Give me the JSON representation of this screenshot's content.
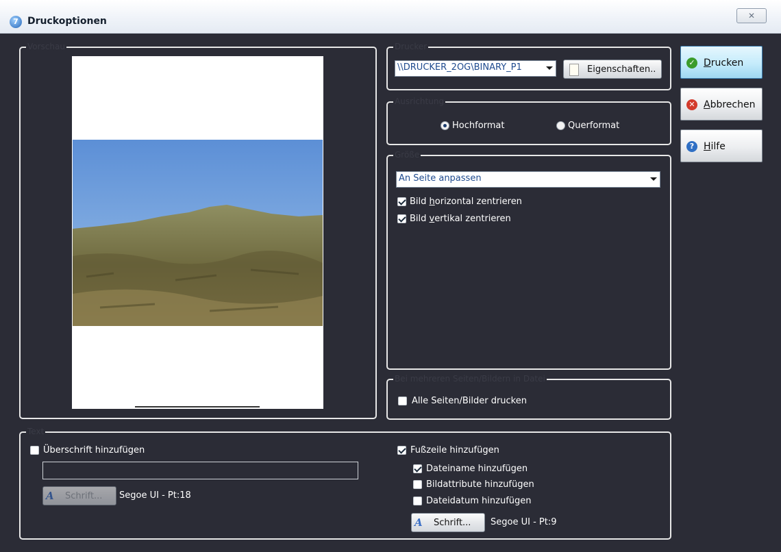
{
  "window": {
    "title": "Druckoptionen",
    "icon": "app-icon",
    "close_symbol": "✕"
  },
  "groups": {
    "preview": "Vorschau",
    "printer": "Drucker",
    "orientation": "Ausrichtung",
    "size": "Größe",
    "multi": "Bei mehreren Seiten/Bildern in Datei",
    "text": "Text"
  },
  "printer": {
    "selected": "\\\\DRUCKER_2OG\\BINARY_P1",
    "properties_button": "Eigenschaften.."
  },
  "orientation": {
    "options": [
      {
        "label": "Hochformat",
        "selected": true
      },
      {
        "label": "Querformat",
        "selected": false
      }
    ]
  },
  "size": {
    "selected": "An Seite anpassen",
    "center_horizontal": {
      "prefix": "Bild ",
      "mnemonic": "h",
      "suffix": "orizontal zentrieren",
      "checked": true
    },
    "center_vertical": {
      "prefix": "Bild ",
      "mnemonic": "v",
      "suffix": "ertikal zentrieren",
      "checked": true
    }
  },
  "multi": {
    "print_all": {
      "label": "Alle Seiten/Bilder drucken",
      "checked": false
    }
  },
  "text": {
    "heading": {
      "label": "Überschrift hinzufügen",
      "checked": false,
      "value": ""
    },
    "heading_font_button": "Schrift...",
    "heading_font_info": "Segoe UI - Pt:18",
    "footer": {
      "label": "Fußzeile hinzufügen",
      "checked": true
    },
    "footer_items": [
      {
        "label": "Dateiname hinzufügen",
        "checked": true
      },
      {
        "label": "Bildattribute hinzufügen",
        "checked": false
      },
      {
        "label": "Dateidatum hinzufügen",
        "checked": false
      }
    ],
    "footer_font_button": "Schrift...",
    "footer_font_info": "Segoe UI - Pt:9"
  },
  "actions": {
    "print": {
      "mnemonic": "D",
      "rest": "rucken",
      "icon": "check-icon"
    },
    "cancel": {
      "mnemonic": "A",
      "rest": "bbrechen",
      "icon": "cancel-icon"
    },
    "help": {
      "mnemonic": "H",
      "rest": "ilfe",
      "icon": "help-icon"
    }
  },
  "colors": {
    "background": "#2b2c36",
    "accent": "#1f4b8f",
    "print_button": "#c4ebfb"
  }
}
